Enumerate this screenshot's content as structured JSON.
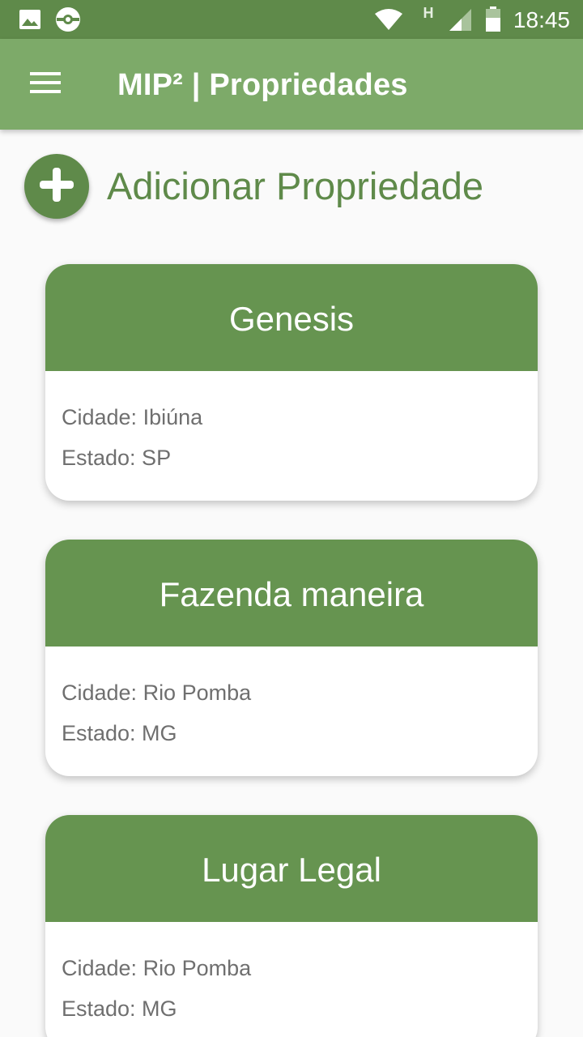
{
  "status_bar": {
    "time": "18:45",
    "network_label": "H",
    "icons": [
      "image-icon",
      "circle-logo-icon",
      "wifi-icon",
      "signal-icon",
      "battery-icon"
    ]
  },
  "app_bar": {
    "title": "MIP² | Propriedades",
    "menu_icon": "hamburger-menu-icon"
  },
  "add_property": {
    "label": "Adicionar Propriedade",
    "icon": "plus-icon"
  },
  "properties": [
    {
      "name": "Genesis",
      "city": "Cidade: Ibiúna",
      "state": "Estado: SP"
    },
    {
      "name": "Fazenda maneira",
      "city": "Cidade: Rio Pomba",
      "state": "Estado: MG"
    },
    {
      "name": "Lugar Legal",
      "city": "Cidade: Rio Pomba",
      "state": "Estado: MG"
    }
  ],
  "colors": {
    "status_bar": "#5f8a4a",
    "app_bar": "#7daa69",
    "accent": "#5f8a4a",
    "card_header": "#669450",
    "card_text": "#6f6f6f"
  }
}
